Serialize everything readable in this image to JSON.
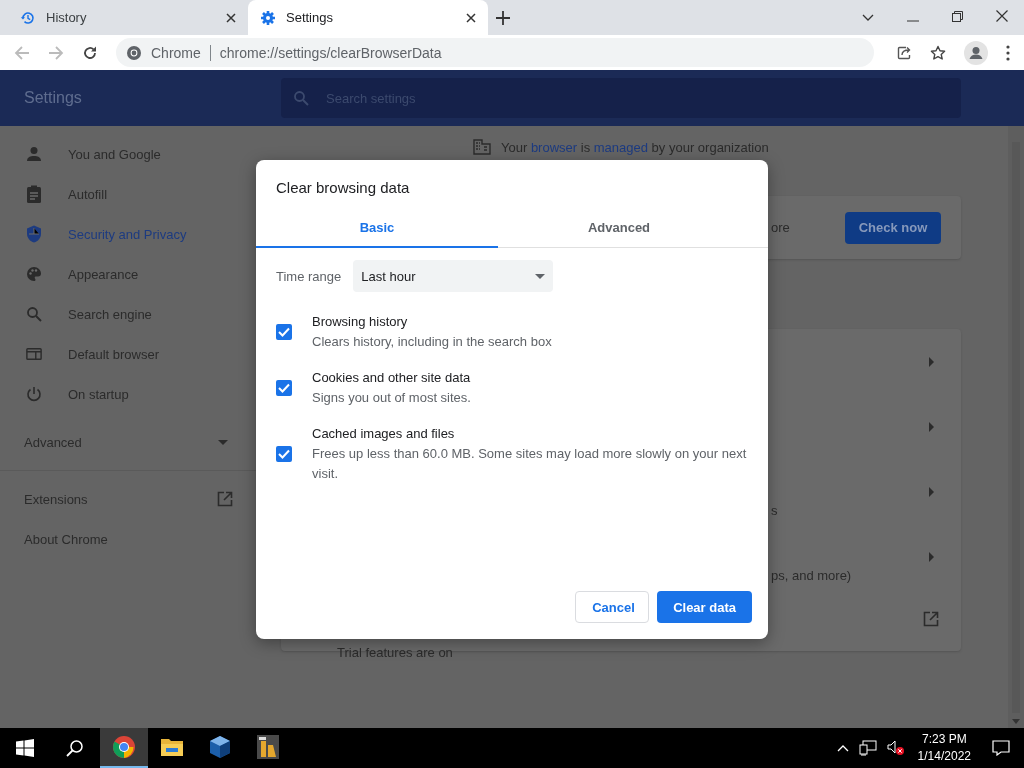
{
  "tabs": [
    {
      "kind": "history",
      "label": "History",
      "selected": false
    },
    {
      "kind": "settings",
      "label": "Settings",
      "selected": true
    }
  ],
  "address_bar": {
    "site_label": "Chrome",
    "url": "chrome://settings/clearBrowserData"
  },
  "settings_header": {
    "title": "Settings",
    "search_placeholder": "Search settings"
  },
  "sidebar": {
    "items": [
      {
        "kind": "person",
        "label": "You and Google",
        "selected": false
      },
      {
        "kind": "clipboard",
        "label": "Autofill",
        "selected": false
      },
      {
        "kind": "shield",
        "label": "Security and Privacy",
        "selected": true
      },
      {
        "kind": "palette",
        "label": "Appearance",
        "selected": false
      },
      {
        "kind": "search",
        "label": "Search engine",
        "selected": false
      },
      {
        "kind": "browser",
        "label": "Default browser",
        "selected": false
      },
      {
        "kind": "power",
        "label": "On startup",
        "selected": false
      }
    ],
    "advanced": {
      "label": "Advanced",
      "expanded": false
    },
    "links": [
      {
        "label": "Extensions",
        "external": true
      },
      {
        "label": "About Chrome",
        "external": false
      }
    ]
  },
  "managed_notice": [
    {
      "text": "Your ",
      "link": false
    },
    {
      "text": "browser",
      "link": true
    },
    {
      "text": " is ",
      "link": false
    },
    {
      "text": "managed",
      "link": true
    },
    {
      "text": " by your organization",
      "link": false
    }
  ],
  "safety_card": {
    "fragment": "ore",
    "button": "Check now"
  },
  "privacy_rows": [
    {
      "fragment": ""
    },
    {
      "fragment": ""
    },
    {
      "fragment": "s"
    },
    {
      "fragment": "ps, and more)"
    }
  ],
  "trial_row": {
    "text": "Trial features are on"
  },
  "dialog": {
    "title": "Clear browsing data",
    "tabs": [
      {
        "label": "Basic",
        "selected": true
      },
      {
        "label": "Advanced",
        "selected": false
      }
    ],
    "time_range": {
      "label": "Time range",
      "value": "Last hour"
    },
    "options": [
      {
        "title": "Browsing history",
        "description": "Clears history, including in the search box",
        "checked": true
      },
      {
        "title": "Cookies and other site data",
        "description": "Signs you out of most sites.",
        "checked": true
      },
      {
        "title": "Cached images and files",
        "description": "Frees up less than 60.0 MB. Some sites may load more slowly on your next visit.",
        "checked": true
      }
    ],
    "cancel": "Cancel",
    "confirm": "Clear data"
  },
  "taskbar": {
    "apps": [
      {
        "kind": "chrome",
        "active": true
      },
      {
        "kind": "folder",
        "active": false
      },
      {
        "kind": "cube",
        "active": false
      },
      {
        "kind": "tool",
        "active": false
      }
    ],
    "time": "7:23 PM",
    "date": "1/14/2022"
  }
}
